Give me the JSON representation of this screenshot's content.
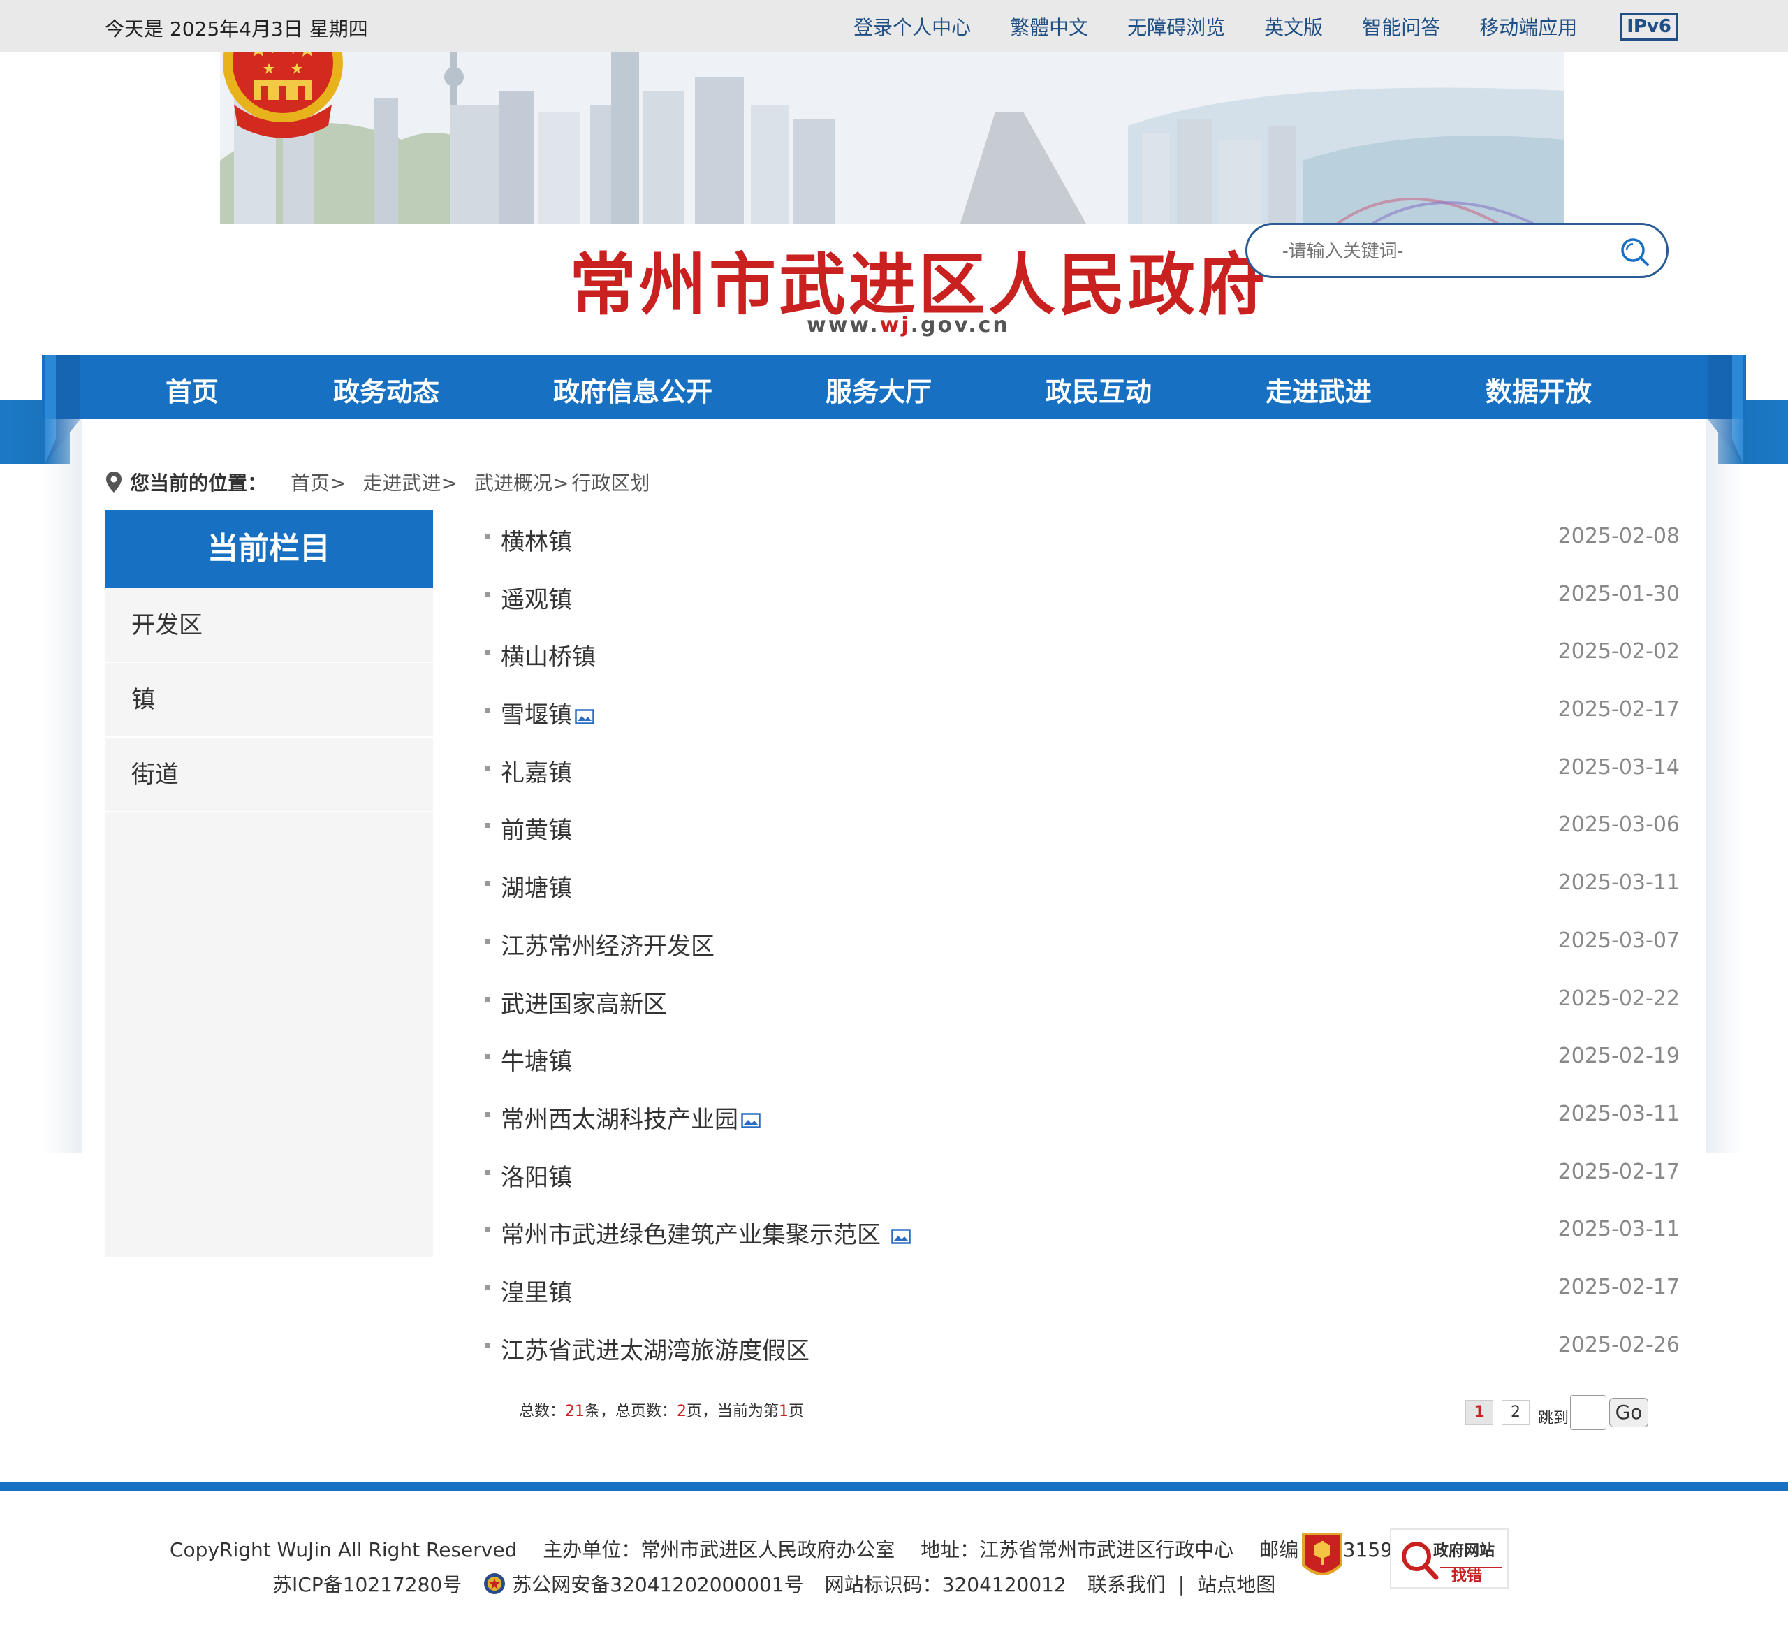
{
  "top_bar": {
    "date_text": "今天是 2025年4月3日 星期四",
    "links": [
      "登录个人中心",
      "繁體中文",
      "无障碍浏览",
      "英文版",
      "智能问答",
      "移动端应用"
    ],
    "ipv6_label": "IPv6"
  },
  "header": {
    "site_title": "常州市武进区人民政府",
    "site_url_prefix": "www.",
    "site_url_highlight": "wj",
    "site_url_suffix": ".gov.cn",
    "emblem_icon": "national-emblem-icon"
  },
  "search": {
    "placeholder": "-请输入关键词-",
    "icon": "search-icon"
  },
  "nav": {
    "items": [
      "首页",
      "政务动态",
      "政府信息公开",
      "服务大厅",
      "政民互动",
      "走进武进",
      "数据开放"
    ]
  },
  "breadcrumb": {
    "label": "您当前的位置：",
    "crumbs": [
      "首页>",
      "走进武进>",
      "武进概况>",
      "行政区划"
    ]
  },
  "sidebar": {
    "header": "当前栏目",
    "items": [
      "开发区",
      "镇",
      "街道"
    ]
  },
  "articles": [
    {
      "title": "横林镇",
      "date": "2025-02-08",
      "has_image": false
    },
    {
      "title": "遥观镇",
      "date": "2025-01-30",
      "has_image": false
    },
    {
      "title": "横山桥镇",
      "date": "2025-02-02",
      "has_image": false
    },
    {
      "title": "雪堰镇",
      "date": "2025-02-17",
      "has_image": true
    },
    {
      "title": "礼嘉镇",
      "date": "2025-03-14",
      "has_image": false
    },
    {
      "title": "前黄镇",
      "date": "2025-03-06",
      "has_image": false
    },
    {
      "title": "湖塘镇",
      "date": "2025-03-11",
      "has_image": false
    },
    {
      "title": "江苏常州经济开发区",
      "date": "2025-03-07",
      "has_image": false
    },
    {
      "title": "武进国家高新区",
      "date": "2025-02-22",
      "has_image": false
    },
    {
      "title": "牛塘镇",
      "date": "2025-02-19",
      "has_image": false
    },
    {
      "title": "常州西太湖科技产业园",
      "date": "2025-03-11",
      "has_image": true
    },
    {
      "title": "洛阳镇",
      "date": "2025-02-17",
      "has_image": false
    },
    {
      "title": "常州市武进绿色建筑产业集聚示范区 ",
      "date": "2025-03-11",
      "has_image": true
    },
    {
      "title": "湟里镇",
      "date": "2025-02-17",
      "has_image": false
    },
    {
      "title": "江苏省武进太湖湾旅游度假区",
      "date": "2025-02-26",
      "has_image": false
    }
  ],
  "pagination": {
    "total_label_prefix": "总数：",
    "total": "21",
    "total_label_mid": "条，总页数：",
    "pages": "2",
    "pages_label_mid": "页，当前为第",
    "current": "1",
    "current_suffix": "页",
    "page_buttons": [
      "1",
      "2"
    ],
    "jump_label": "跳到",
    "go_label": "Go"
  },
  "footer": {
    "copyright": "CopyRight WuJin All Right Reserved",
    "host": "主办单位：常州市武进区人民政府办公室",
    "address": "地址：江苏省常州市武进区行政中心",
    "postcode": "邮编：213159",
    "icp": "苏ICP备10217280号",
    "police": "苏公网安备32041202000001号",
    "site_code": "网站标识码：3204120012",
    "contact": "联系我们",
    "separator": "|",
    "sitemap": "站点地图",
    "findbug_line1": "政府网站",
    "findbug_line2": "找错"
  },
  "colors": {
    "brand_blue": "#1770c2",
    "title_red": "#c8211f",
    "link_blue": "#1f4f84"
  }
}
